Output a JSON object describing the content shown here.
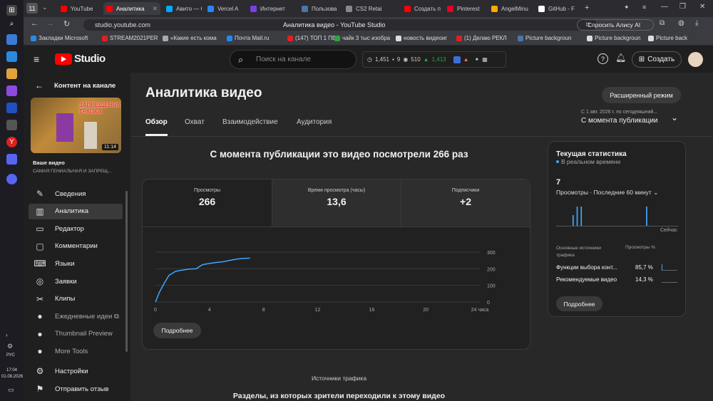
{
  "os": {
    "time": "17:04",
    "date": "01.08.2026",
    "lang": "РУС"
  },
  "tabs": [
    {
      "label": "YouTube",
      "color": "#ff0000"
    },
    {
      "label": "Аналитика",
      "color": "#ff0000",
      "active": true
    },
    {
      "label": "Авито — С",
      "color": "#00aaff"
    },
    {
      "label": "Vercel A",
      "color": "#2787f5"
    },
    {
      "label": "Интернет",
      "color": "#7b3fe4"
    },
    {
      "label": "Пользова",
      "color": "#4a76a8"
    },
    {
      "label": "CS2 Retai",
      "color": "#888888"
    },
    {
      "label": "Создать п",
      "color": "#ff0000"
    },
    {
      "label": "Pinterest",
      "color": "#e60023"
    },
    {
      "label": "AngelMinu",
      "color": "#ffaa00"
    },
    {
      "label": "GitHub - F",
      "color": "#ffffff"
    }
  ],
  "browser": {
    "url": "studio.youtube.com",
    "page_title": "Аналитика видео - YouTube Studio",
    "alice": "Спросить Алису AI",
    "tab_count": "11"
  },
  "bookmarks": [
    "Закладки Microsoft",
    "STREAM2021PER",
    "«Какие есть кома",
    "Почта Mail.ru",
    "(147) ТОП 1 ПЕС",
    "чайк 3 тыс изобра",
    "новость видеоиг",
    "(1) Делаю РЕКЛ",
    "Picture backgroun",
    "Picture backgroun",
    "Picture back"
  ],
  "header": {
    "logo": "Studio",
    "search_placeholder": "Поиск на канале",
    "stats": [
      "1,451",
      "9",
      "510",
      "1,413"
    ],
    "create": "Создать"
  },
  "nav": {
    "back": "Контент на канале",
    "thumb_title": "ЗАПРЕЩЕННА ТРАПКА",
    "duration": "11:14",
    "video_label": "Ваше видео",
    "video_title": "САМАЯ ГЕНИАЛЬНАЯ И ЗАПРЕЩ...",
    "items": [
      {
        "label": "Сведения",
        "icon": "✎"
      },
      {
        "label": "Аналитика",
        "icon": "▥",
        "selected": true
      },
      {
        "label": "Редактор",
        "icon": "▭"
      },
      {
        "label": "Комментарии",
        "icon": "▢"
      },
      {
        "label": "Языки",
        "icon": "⌨"
      },
      {
        "label": "Заявки",
        "icon": "◎"
      },
      {
        "label": "Клипы",
        "icon": "✂"
      },
      {
        "label": "Ежедневные идеи ⧉",
        "icon": "●",
        "dim": true
      },
      {
        "label": "Thumbnail Preview",
        "icon": "●",
        "dim": true
      },
      {
        "label": "More Tools",
        "icon": "●",
        "dim": true
      }
    ],
    "settings": "Настройки",
    "feedback": "Отправить отзыв"
  },
  "main": {
    "title": "Аналитика видео",
    "advanced": "Расширенный режим",
    "tabs": [
      "Обзор",
      "Охват",
      "Взаимодействие",
      "Аудитория"
    ],
    "period_sub": "С 1 авг. 2026 г. по сегодняшний...",
    "period": "С момента публикации",
    "headline": "С момента публикации это видео посмотрели 266 раз",
    "metrics": [
      {
        "label": "Просмотры",
        "value": "266"
      },
      {
        "label": "Время просмотра (часы)",
        "value": "13,6"
      },
      {
        "label": "Подписчики",
        "value": "+2"
      }
    ],
    "more": "Подробнее",
    "traffic_caption": "Источники трафика",
    "traffic_sub": "Разделы, из которых зрители переходили к этому видео"
  },
  "chart_data": {
    "type": "line",
    "x": [
      0,
      0.3,
      0.7,
      1,
      1.5,
      2,
      2.5,
      3,
      3.5,
      4,
      4.5,
      5,
      5.5,
      6,
      6.5,
      7
    ],
    "values": [
      0,
      60,
      120,
      160,
      185,
      192,
      198,
      200,
      225,
      232,
      238,
      242,
      250,
      258,
      262,
      264
    ],
    "x_ticks": [
      "0",
      "4",
      "8",
      "12",
      "16",
      "20",
      "24 часа"
    ],
    "x_tick_values": [
      0,
      4,
      8,
      12,
      16,
      20,
      24
    ],
    "y_ticks": [
      "0",
      "100",
      "200",
      "300"
    ],
    "ylim": [
      0,
      300
    ],
    "xlim": [
      0,
      24
    ],
    "color": "#3ea6ff"
  },
  "realtime": {
    "title": "Текущая статистика",
    "live": "В реальном времени",
    "count": "7",
    "period": "Просмотры · Последние 60 минут",
    "now": "Сейчас",
    "bars": [
      0,
      0,
      0,
      0,
      0,
      0,
      0,
      0,
      0.5,
      0,
      0.9,
      0,
      0.9,
      0,
      0,
      0,
      0,
      0,
      0,
      0,
      0,
      0,
      0,
      0,
      0,
      0,
      0,
      0,
      0,
      0,
      0,
      0,
      0,
      0,
      0,
      0,
      0,
      0,
      0,
      0,
      0,
      0,
      0,
      0,
      0.9,
      0,
      0,
      0,
      0,
      0,
      0,
      0,
      0,
      0,
      0,
      0,
      0,
      0,
      0,
      0
    ],
    "sources_label": "Основные источники трафика",
    "views_label": "Просмотры %",
    "sources": [
      {
        "name": "Функции выбора конт...",
        "pct": "85,7 %"
      },
      {
        "name": "Рекомендуемые видео",
        "pct": "14,3 %"
      }
    ],
    "more": "Подробнее"
  }
}
